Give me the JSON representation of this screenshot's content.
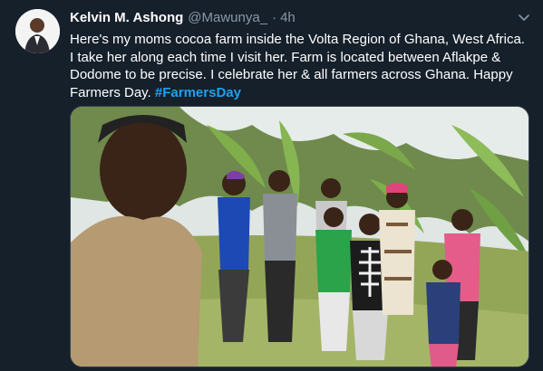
{
  "tweet": {
    "author_name": "Kelvin M. Ashong",
    "handle": "@Mawunya_",
    "separator": "·",
    "time": "4h",
    "text": "Here's my moms cocoa farm inside the Volta Region of Ghana, West Africa. I take her along each time I visit her. Farm is located between Aflakpe & Dodome to be precise. I celebrate her & all farmers across Ghana. Happy Farmers Day. ",
    "hashtag": "#FarmersDay",
    "more_icon": "chevron-down-icon",
    "photo": "farm-group-photo"
  },
  "colors": {
    "background": "#15202b",
    "text": "#ffffff",
    "muted": "#8899a6",
    "link": "#1da1f2"
  }
}
